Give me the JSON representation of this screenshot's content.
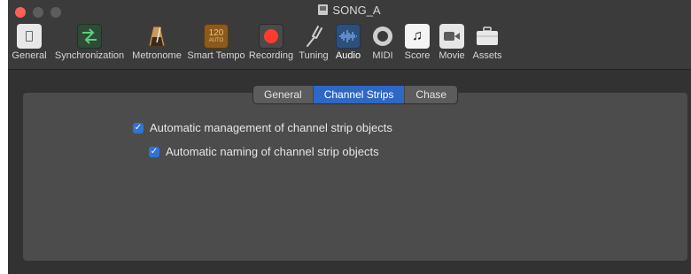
{
  "window": {
    "title": "SONG_A"
  },
  "toolbar": {
    "items": [
      {
        "label": "General",
        "icon": "switch-icon"
      },
      {
        "label": "Synchronization",
        "icon": "sync-arrows-icon"
      },
      {
        "label": "Metronome",
        "icon": "metronome-icon"
      },
      {
        "label": "Smart Tempo",
        "icon": "tempo-display-icon",
        "icon_text": "120",
        "icon_subtext": "AUTO"
      },
      {
        "label": "Recording",
        "icon": "record-icon"
      },
      {
        "label": "Tuning",
        "icon": "tuning-fork-icon"
      },
      {
        "label": "Audio",
        "icon": "waveform-icon",
        "selected": true
      },
      {
        "label": "MIDI",
        "icon": "midi-port-icon"
      },
      {
        "label": "Score",
        "icon": "music-note-icon",
        "icon_text": "♫"
      },
      {
        "label": "Movie",
        "icon": "video-camera-icon"
      },
      {
        "label": "Assets",
        "icon": "briefcase-icon"
      }
    ]
  },
  "tabs": [
    {
      "label": "General",
      "selected": false
    },
    {
      "label": "Channel Strips",
      "selected": true
    },
    {
      "label": "Chase",
      "selected": false
    }
  ],
  "options": {
    "auto_management": {
      "label": "Automatic management of channel strip objects",
      "checked": true
    },
    "auto_naming": {
      "label": "Automatic naming of channel strip objects",
      "checked": true
    }
  },
  "colors": {
    "accent": "#2f67c5",
    "checkbox": "#2f73d8",
    "record": "#ff3b30",
    "close": "#fe5f57"
  }
}
